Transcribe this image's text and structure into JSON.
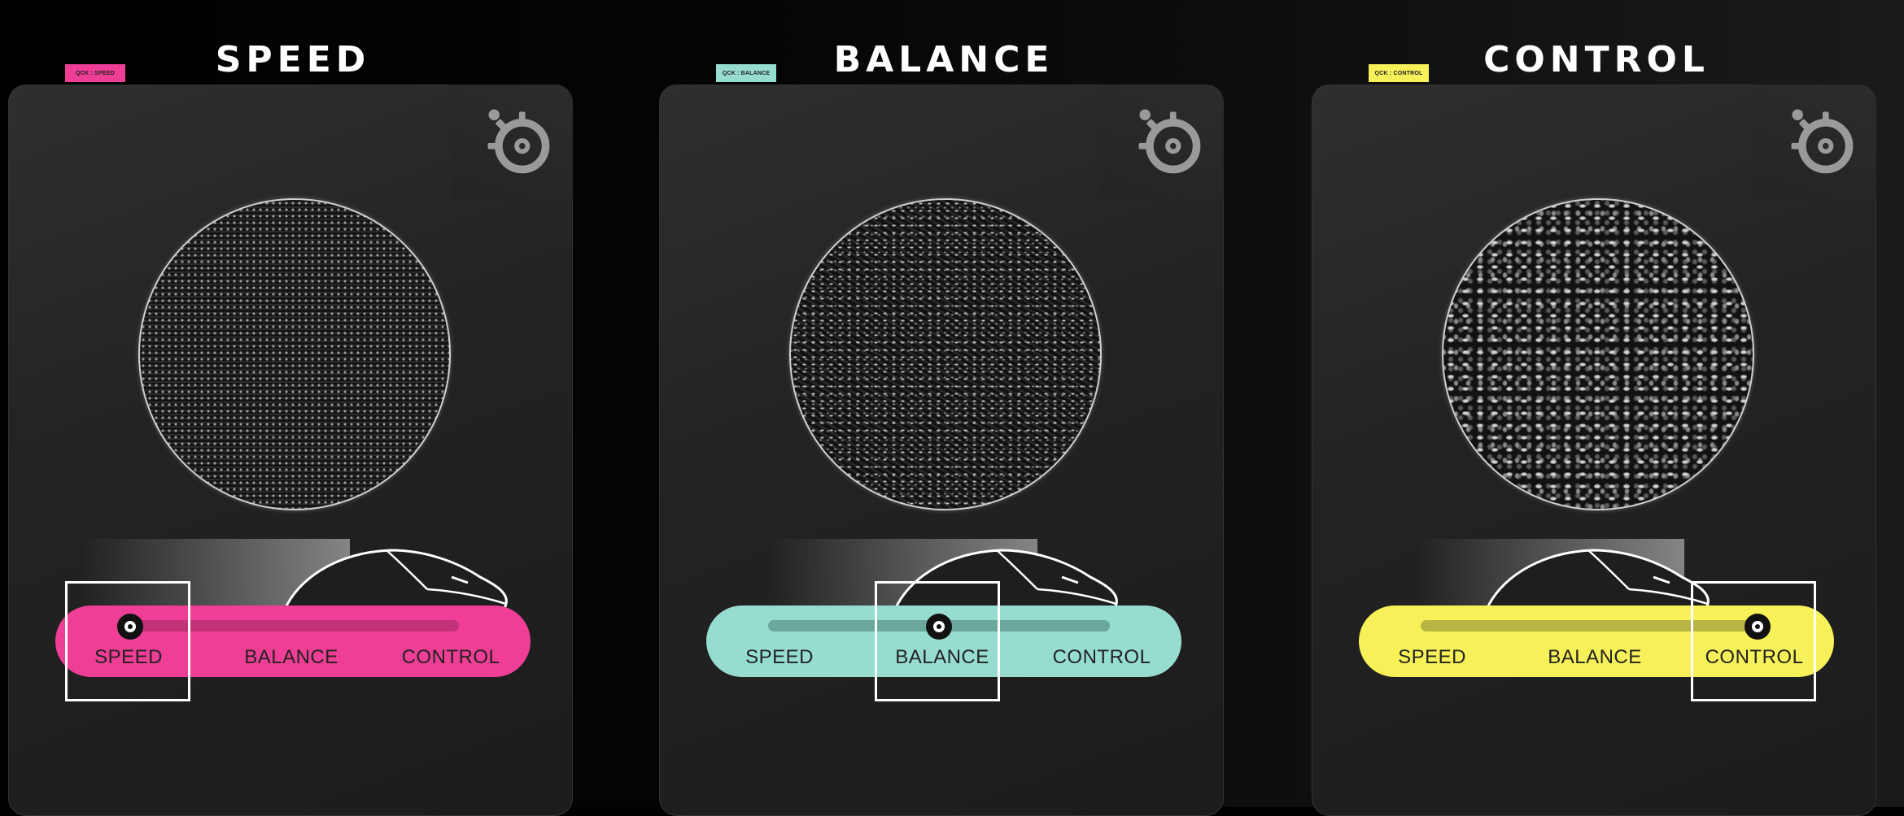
{
  "panels": [
    {
      "tag": "QCK : SPEED",
      "title": "SPEED",
      "accent": "#ee3e95",
      "track_color": "#c23077",
      "texture": "speed",
      "slider_position": 0.0,
      "labels": [
        "SPEED",
        "BALANCE",
        "CONTROL"
      ],
      "logo_icon": "steelseries-logo-icon"
    },
    {
      "tag": "QCK : BALANCE",
      "title": "BALANCE",
      "accent": "#96ddd0",
      "track_color": "#6aa89b",
      "texture": "balance",
      "slider_position": 0.5,
      "labels": [
        "SPEED",
        "BALANCE",
        "CONTROL"
      ],
      "logo_icon": "steelseries-logo-icon"
    },
    {
      "tag": "QCK : CONTROL",
      "title": "CONTROL",
      "accent": "#f7f159",
      "track_color": "#b9b544",
      "texture": "control",
      "slider_position": 1.0,
      "labels": [
        "SPEED",
        "BALANCE",
        "CONTROL"
      ],
      "logo_icon": "steelseries-logo-icon"
    }
  ]
}
